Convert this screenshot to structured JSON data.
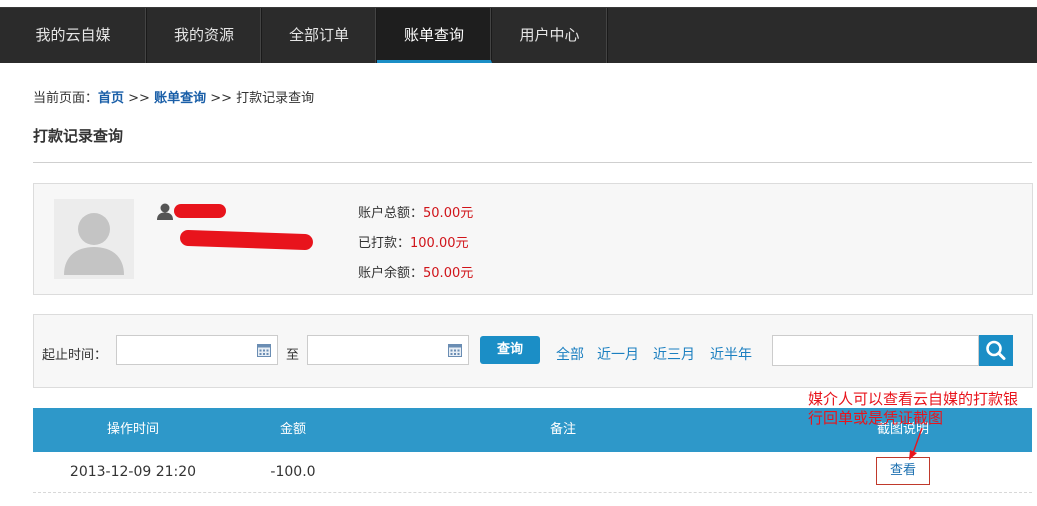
{
  "nav": {
    "tabs": [
      {
        "label": "我的云自媒",
        "active": false
      },
      {
        "label": "我的资源",
        "active": false
      },
      {
        "label": "全部订单",
        "active": false
      },
      {
        "label": "账单查询",
        "active": true
      },
      {
        "label": "用户中心",
        "active": false
      }
    ]
  },
  "breadcrumb": {
    "prefix": "当前页面：",
    "home": "首页",
    "sep1": " >> ",
    "billing": "账单查询",
    "sep2": " >> ",
    "current": "打款记录查询"
  },
  "page_title": "打款记录查询",
  "account": {
    "total_label": "账户总额：",
    "total_value": "50.00元",
    "paid_label": "已打款：",
    "paid_value": "100.00元",
    "balance_label": "账户余额：",
    "balance_value": "50.00元"
  },
  "filter": {
    "range_label": "起止时间：",
    "start_value": "",
    "to_label": "至",
    "end_value": "",
    "query_label": "查询",
    "quick_ranges": [
      "全部",
      "近一月",
      "近三月",
      "近半年"
    ],
    "search_value": ""
  },
  "table": {
    "headers": [
      "操作时间",
      "金额",
      "备注",
      "截图说明"
    ],
    "rows": [
      {
        "time": "2013-12-09 21:20",
        "amount": "-100.0",
        "note": "",
        "action": "查看"
      }
    ]
  },
  "annotation": {
    "text": "媒介人可以查看云自媒的打款银行回单或是凭证截图"
  },
  "colors": {
    "nav_bg": "#2b2b2b",
    "accent": "#1b8ec6",
    "table_header": "#2e98c9",
    "money_red": "#d0141a",
    "link_blue": "#1b7fc0"
  }
}
